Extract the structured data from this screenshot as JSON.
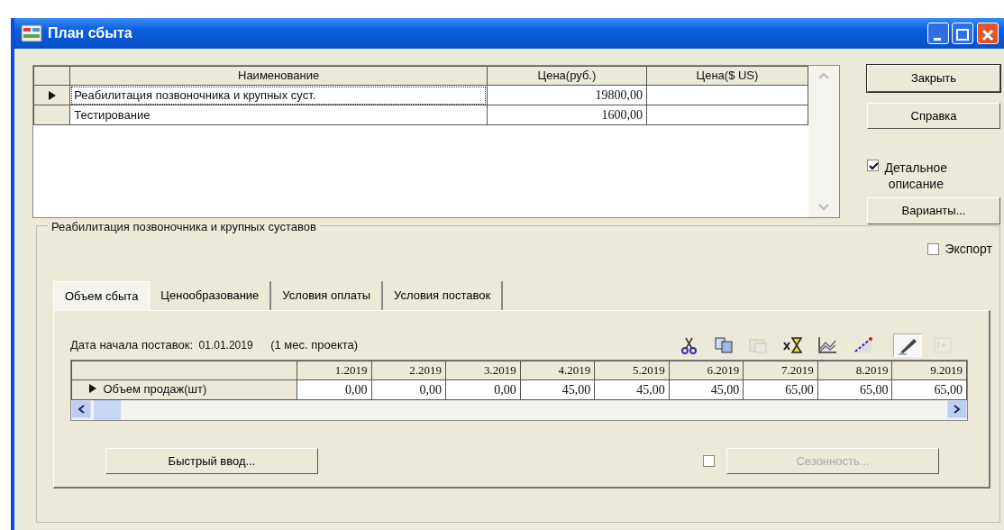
{
  "window": {
    "title": "План сбыта"
  },
  "products": {
    "columns": [
      "Наименование",
      "Цена(руб.)",
      "Цена($ US)"
    ],
    "rows": [
      {
        "selected": true,
        "cells": [
          "Реабилитация позвоночника и крупных суст.",
          "19800,00",
          ""
        ]
      },
      {
        "selected": false,
        "cells": [
          "Тестирование",
          "1600,00",
          ""
        ]
      }
    ]
  },
  "side": {
    "buttons": [
      {
        "label": "Закрыть",
        "default": true
      },
      {
        "label": "Справка",
        "default": false
      }
    ],
    "detail_checkbox": {
      "label_lines": [
        "Детальное",
        "описание"
      ],
      "checked": true
    },
    "variants_button": "Варианты...",
    "export_checkbox": {
      "label": "Экспорт",
      "checked": false
    }
  },
  "group": {
    "title": "Реабилитация позвоночника и крупных суставов"
  },
  "tabs": [
    {
      "label": "Объем сбыта",
      "selected": true
    },
    {
      "label": "Ценообразование",
      "selected": false
    },
    {
      "label": "Условия оплаты",
      "selected": false
    },
    {
      "label": "Условия поставок",
      "selected": false
    }
  ],
  "start": {
    "label": "Дата начала поставок:",
    "date": "01.01.2019",
    "note": "(1 мес. проекта)"
  },
  "toolbar": [
    {
      "kind": "cut",
      "disabled": false,
      "pressed": false
    },
    {
      "kind": "copy",
      "disabled": false,
      "pressed": false
    },
    {
      "kind": "paste",
      "disabled": true,
      "pressed": false
    },
    {
      "kind": "fill",
      "disabled": false,
      "pressed": false
    },
    {
      "kind": "chart",
      "disabled": false,
      "pressed": false
    },
    {
      "kind": "trend",
      "disabled": false,
      "pressed": false
    },
    {
      "kind": "pencil",
      "disabled": false,
      "pressed": true
    },
    {
      "kind": "formula",
      "disabled": true,
      "pressed": false
    }
  ],
  "volume": {
    "periods": [
      "1.2019",
      "2.2019",
      "3.2019",
      "4.2019",
      "5.2019",
      "6.2019",
      "7.2019",
      "8.2019",
      "9.2019"
    ],
    "rows": [
      {
        "label": "Объем продаж(шт)",
        "selected": true,
        "values": [
          "0,00",
          "0,00",
          "0,00",
          "45,00",
          "45,00",
          "45,00",
          "65,00",
          "65,00",
          "65,00"
        ]
      }
    ]
  },
  "quick_button": "Быстрый ввод...",
  "seasonality": {
    "checked": false,
    "button": "Сезонность...",
    "disabled": true
  }
}
